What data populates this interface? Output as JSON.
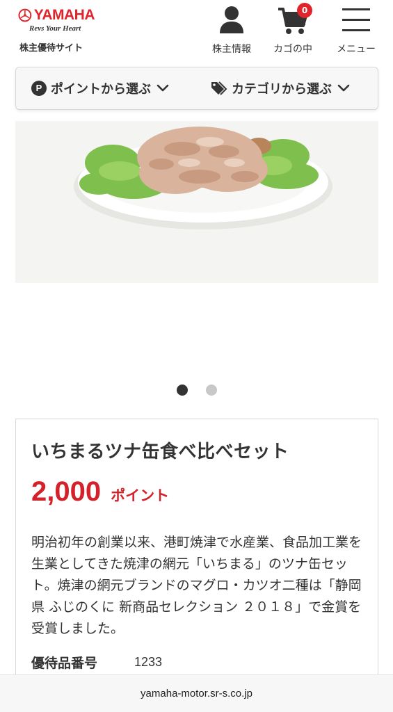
{
  "header": {
    "logo": {
      "brand": "YAMAHA",
      "tagline": "Revs Your Heart"
    },
    "site_name": "株主優待サイト",
    "member_label": "株主情報",
    "cart_label": "カゴの中",
    "cart_count": "0",
    "menu_label": "メニュー",
    "icons": {
      "member": "person-icon",
      "cart": "cart-icon",
      "menu": "hamburger-menu-icon"
    }
  },
  "filters": {
    "points_badge": "P",
    "points_label": "ポイントから選ぶ",
    "category_label": "カテゴリから選ぶ",
    "icons": {
      "points": "p-badge-icon",
      "category": "tag-icon",
      "chevron": "chevron-down-icon"
    }
  },
  "carousel": {
    "slide_count": 2,
    "active_index": 0
  },
  "product": {
    "title": "いちまるツナ缶食べ比べセット",
    "price_value": "2,000",
    "price_unit": "ポイント",
    "description": "明治初年の創業以来、港町焼津で水産業、食品加工業を生業としてきた焼津の網元「いちまる」のツナ缶セット。焼津の網元ブランドのマグロ・カツオ二種は「静岡県 ふじのくに 新商品セレクション ２０１８」で金賞を受賞しました。",
    "spec_label": "優待品番号",
    "spec_value": "1233"
  },
  "browser": {
    "url": "yamaha-motor.sr-s.co.jp"
  },
  "colors": {
    "accent_red": "#d3222a",
    "text": "#333333"
  }
}
